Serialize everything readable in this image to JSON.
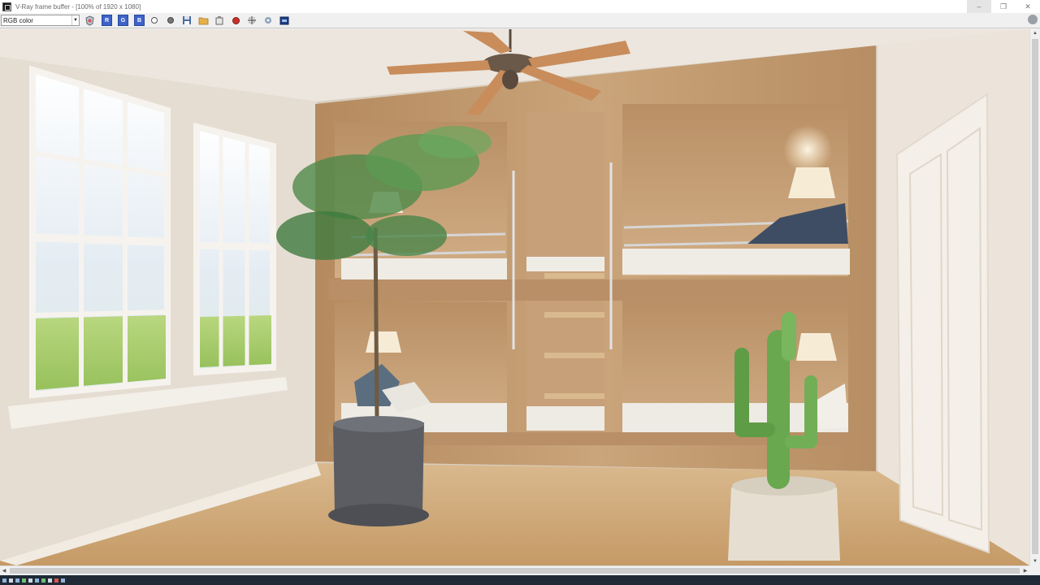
{
  "window": {
    "title": "V-Ray frame buffer - [100% of 1920 x 1080]",
    "controls": {
      "minimize": "–",
      "restore": "❐",
      "close": "✕"
    }
  },
  "toolbar": {
    "channel_select": "RGB color",
    "channel_buttons": [
      "R",
      "G",
      "B"
    ]
  },
  "scrollbars": {
    "up": "▲",
    "down": "▼",
    "left": "◀",
    "right": "▶"
  },
  "colors": {
    "channel_button": "#3d63c9",
    "stop_render": "#c9302c"
  }
}
